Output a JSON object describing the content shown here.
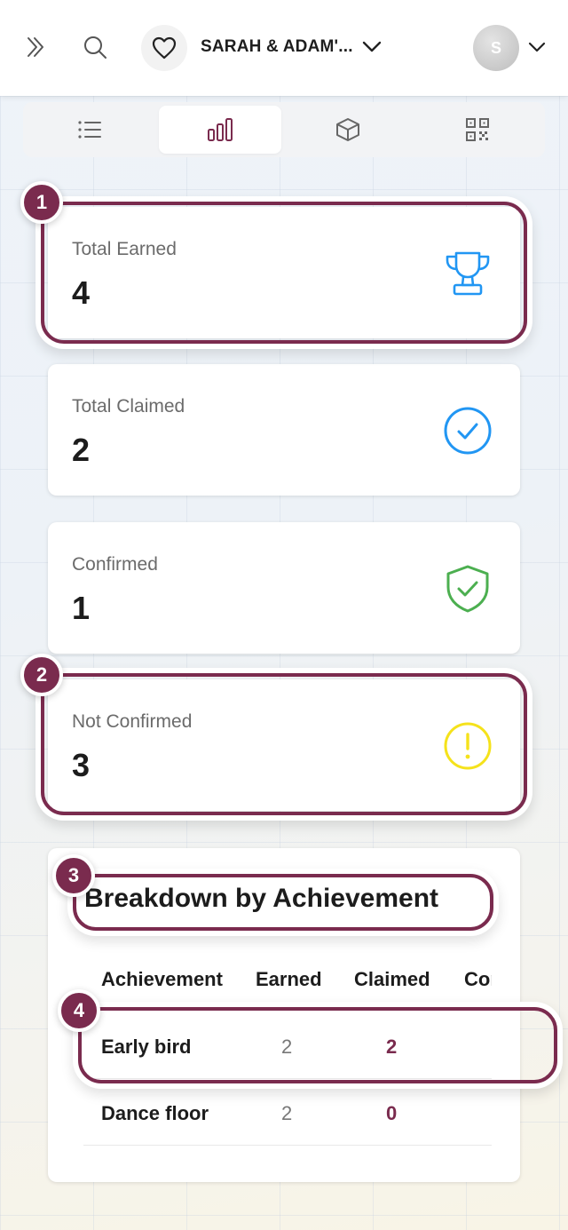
{
  "header": {
    "event_title": "SARAH & ADAM'...",
    "avatar_initial": "S",
    "icons": {
      "expand": "double-chevron-right-icon",
      "search": "search-icon",
      "event": "heart-icon",
      "event_menu": "chevron-down-icon",
      "account_menu": "chevron-down-icon"
    }
  },
  "tabs": [
    {
      "name": "list",
      "icon": "list-icon",
      "active": false
    },
    {
      "name": "stats",
      "icon": "bar-chart-icon",
      "active": true
    },
    {
      "name": "packages",
      "icon": "cube-icon",
      "active": false
    },
    {
      "name": "qr",
      "icon": "qr-code-icon",
      "active": false
    }
  ],
  "stats": {
    "total_earned": {
      "label": "Total Earned",
      "value": "4",
      "icon": "trophy-icon",
      "color": "#2196f3"
    },
    "total_claimed": {
      "label": "Total Claimed",
      "value": "2",
      "icon": "check-circle-icon",
      "color": "#2196f3"
    },
    "confirmed": {
      "label": "Confirmed",
      "value": "1",
      "icon": "shield-check-icon",
      "color": "#4caf50"
    },
    "not_confirmed": {
      "label": "Not Confirmed",
      "value": "3",
      "icon": "alert-circle-icon",
      "color": "#f5e21b"
    }
  },
  "breakdown": {
    "title": "Breakdown by Achievement",
    "columns": [
      "Achievement",
      "Earned",
      "Claimed",
      "Confirmed"
    ],
    "rows": [
      {
        "achievement": "Early bird",
        "earned": "2",
        "claimed": "2"
      },
      {
        "achievement": "Dance floor",
        "earned": "2",
        "claimed": "0"
      }
    ]
  },
  "annotations": [
    "1",
    "2",
    "3",
    "4"
  ],
  "colors": {
    "accent": "#7a2b4e",
    "blue": "#2196f3",
    "green": "#4caf50",
    "yellow": "#f5e21b"
  }
}
